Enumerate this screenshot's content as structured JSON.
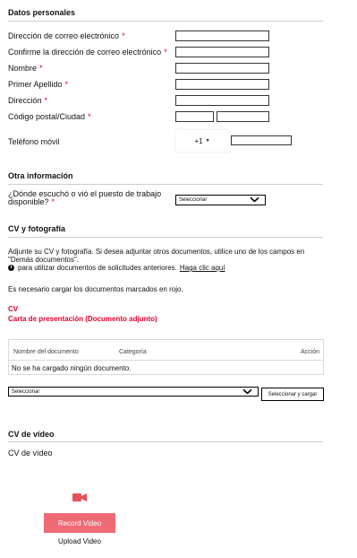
{
  "personal": {
    "title": "Datos personales",
    "fields": {
      "email": "Dirección de correo electrónico",
      "email_confirm": "Confirme la dirección de correo electrónico",
      "name": "Nombre",
      "surname": "Primer Apellido",
      "address": "Dirección",
      "postal": "Código postal/Ciudad",
      "phone": "Teléfono móvil"
    },
    "phone_prefix": "+1",
    "required_mark": "*"
  },
  "other": {
    "title": "Otra información",
    "question_line1": "¿Dónde escuchó o vió el puesto de trabajo",
    "question_line2": "disponible?",
    "select_value": "Seleccionar"
  },
  "cv": {
    "title": "CV y fotografía",
    "intro_line1": "Adjunte su CV y fotografía. Si desea adjuntar otros documentos, utilice uno de los campos en",
    "intro_line2": "\"Demás documentos\".",
    "info_text": "para utilizar documentos de solicitudes anteriores.",
    "info_link": "Haga clic aquí",
    "note": "Es necesario cargar los documentos marcados en rojo.",
    "cv_label": "CV",
    "cover_label": "Carta de presentación (Documento adjunto)",
    "table_headers": [
      "Nombre del documento",
      "Categoría",
      "Acción"
    ],
    "empty_text": "No se ha cargado ningún documento.",
    "upload_select_value": "Seleccionar",
    "upload_button": "Seleccionar y cargar"
  },
  "video": {
    "title": "CV de vídeo",
    "label": "CV de vídeo",
    "record_button": "Record Video",
    "upload_link": "Upload Video"
  },
  "colors": {
    "required": "#e4002b",
    "record_button": "#ee6b76",
    "camera_icon": "#e8505b"
  }
}
